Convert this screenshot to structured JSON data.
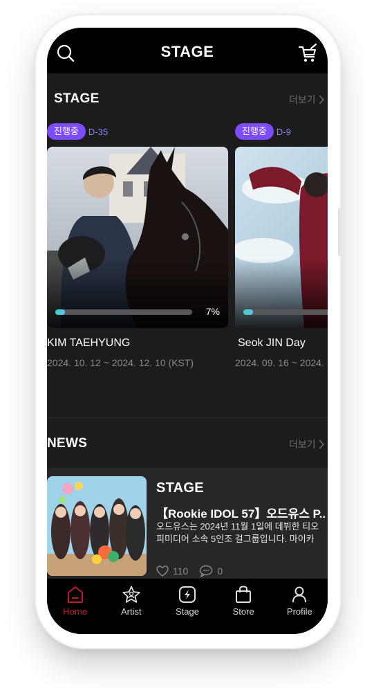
{
  "app": {
    "title": "STAGE"
  },
  "theme": {
    "accent": "#7c4dff",
    "active_nav": "#c0192c",
    "progress": "#35d6b7"
  },
  "header": {
    "left_icon": "search-icon",
    "right_icon": "cart-icon"
  },
  "stage_section": {
    "title": "STAGE",
    "more_label": "더보기",
    "cards": [
      {
        "badge": "진행중",
        "dday": "D-35",
        "progress_percent": 7,
        "progress_label": "7%",
        "name": "KIM TAEHYUNG",
        "date_range": "2024. 10. 12 ~ 2024. 12. 10 (KST)"
      },
      {
        "badge": "진행중",
        "dday": "D-9",
        "progress_percent": 5,
        "name": "Seok JIN Day",
        "date_range": "2024. 09. 16 ~ 2024."
      }
    ]
  },
  "news_section": {
    "title": "NEWS",
    "more_label": "더보기",
    "items": [
      {
        "brand": "STAGE",
        "headline": "【Rookie IDOL 57】오드유스 P...",
        "body": "오드유스는 2024년 11월 1일에 데뷔한 티오피미디어 소속 5인조 걸그룹입니다. 마이카",
        "likes": "110",
        "comments": "0"
      }
    ]
  },
  "bottom_nav": [
    {
      "label": "Home",
      "icon": "home-icon",
      "active": true
    },
    {
      "label": "Artist",
      "icon": "star-icon",
      "active": false
    },
    {
      "label": "Stage",
      "icon": "stage-icon",
      "active": false
    },
    {
      "label": "Store",
      "icon": "shopping-bag-icon",
      "active": false
    },
    {
      "label": "Profile",
      "icon": "profile-icon",
      "active": false
    }
  ]
}
